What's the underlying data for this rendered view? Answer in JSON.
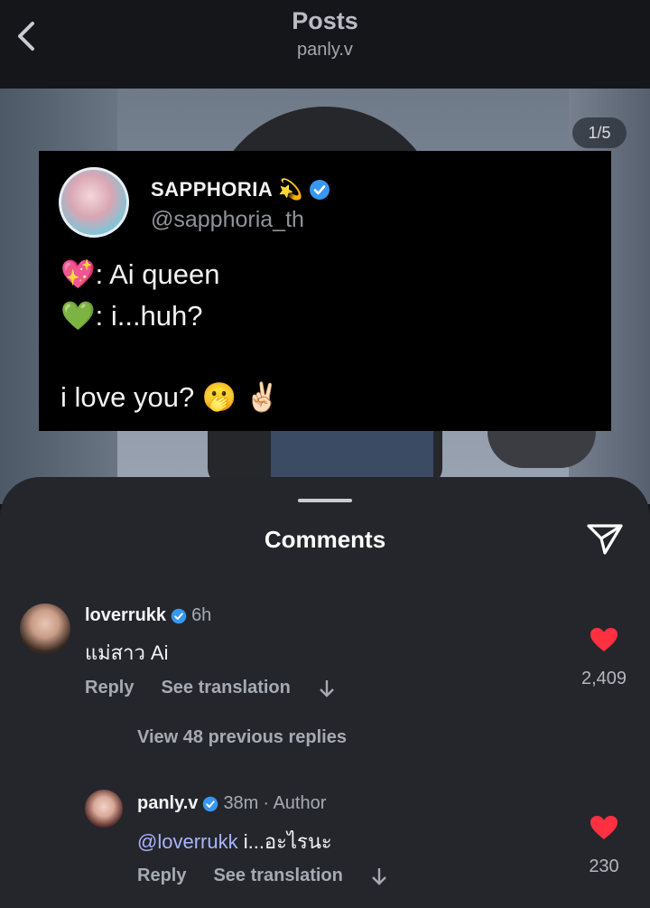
{
  "header": {
    "title": "Posts",
    "username": "panly.v"
  },
  "post": {
    "page_indicator": "1/5",
    "tweet": {
      "display_name": "SAPPHORIA",
      "name_emoji": "💫",
      "handle": "@sapphoria_th",
      "lines": [
        {
          "emoji": "💖",
          "text": ": Ai queen"
        },
        {
          "emoji": "💚",
          "text": ": i...huh?"
        },
        {
          "emoji": "",
          "text": "i love you? 🫢 ✌🏻"
        }
      ]
    }
  },
  "comments_sheet": {
    "title": "Comments",
    "comments": [
      {
        "username": "loverrukk",
        "time": "6h",
        "text": "แม่สาว Ai",
        "reply_label": "Reply",
        "translate_label": "See translation",
        "likes": "2,409"
      }
    ],
    "view_replies_label": "View 48 previous replies",
    "replies": [
      {
        "username": "panly.v",
        "time": "38m",
        "author_tag": "· Author",
        "mention": "@loverrukk",
        "text": " i...อะไรนะ",
        "reply_label": "Reply",
        "translate_label": "See translation",
        "likes": "230"
      }
    ]
  },
  "colors": {
    "verified": "#3897f0",
    "heart": "#ff3040",
    "mention": "#a7b4ff"
  }
}
